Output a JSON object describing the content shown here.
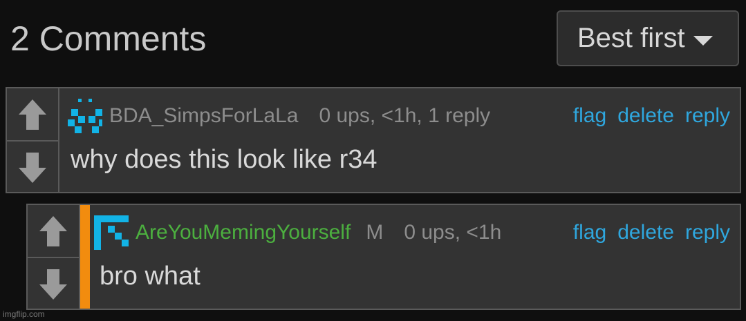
{
  "header": {
    "title": "2 Comments",
    "sort_label": "Best first"
  },
  "comments": [
    {
      "username": "BDA_SimpsForLaLa",
      "badge": "",
      "stats": "0 ups, <1h, 1 reply",
      "text": "why does this look like r34",
      "actions": {
        "flag": "flag",
        "delete": "delete",
        "reply": "reply"
      },
      "avatar_color": "#12b3e6"
    },
    {
      "username": "AreYouMemingYourself",
      "badge": "M",
      "stats": "0 ups, <1h",
      "text": "bro what",
      "actions": {
        "flag": "flag",
        "delete": "delete",
        "reply": "reply"
      },
      "avatar_color": "#12b3e6",
      "username_color": "#4caf3f",
      "reply_accent": "#f28c0f"
    }
  ],
  "watermark": "imgflip.com"
}
